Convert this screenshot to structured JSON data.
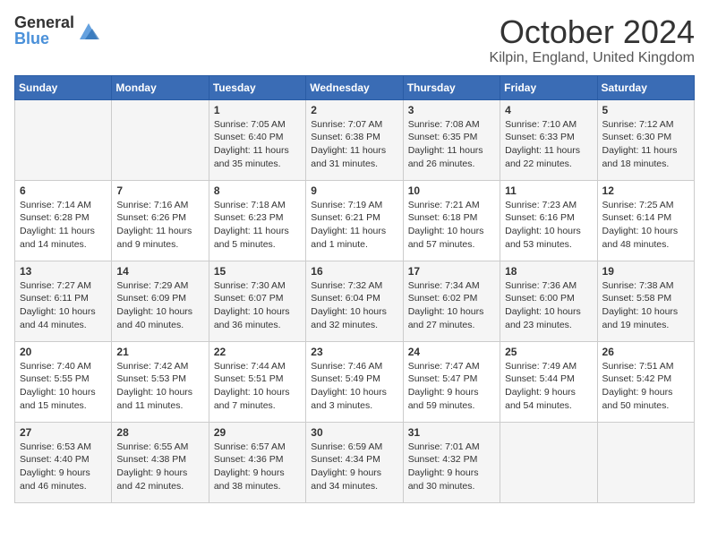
{
  "header": {
    "logo_general": "General",
    "logo_blue": "Blue",
    "month_title": "October 2024",
    "location": "Kilpin, England, United Kingdom"
  },
  "weekdays": [
    "Sunday",
    "Monday",
    "Tuesday",
    "Wednesday",
    "Thursday",
    "Friday",
    "Saturday"
  ],
  "weeks": [
    [
      {
        "day": "",
        "info": ""
      },
      {
        "day": "",
        "info": ""
      },
      {
        "day": "1",
        "info": "Sunrise: 7:05 AM\nSunset: 6:40 PM\nDaylight: 11 hours and 35 minutes."
      },
      {
        "day": "2",
        "info": "Sunrise: 7:07 AM\nSunset: 6:38 PM\nDaylight: 11 hours and 31 minutes."
      },
      {
        "day": "3",
        "info": "Sunrise: 7:08 AM\nSunset: 6:35 PM\nDaylight: 11 hours and 26 minutes."
      },
      {
        "day": "4",
        "info": "Sunrise: 7:10 AM\nSunset: 6:33 PM\nDaylight: 11 hours and 22 minutes."
      },
      {
        "day": "5",
        "info": "Sunrise: 7:12 AM\nSunset: 6:30 PM\nDaylight: 11 hours and 18 minutes."
      }
    ],
    [
      {
        "day": "6",
        "info": "Sunrise: 7:14 AM\nSunset: 6:28 PM\nDaylight: 11 hours and 14 minutes."
      },
      {
        "day": "7",
        "info": "Sunrise: 7:16 AM\nSunset: 6:26 PM\nDaylight: 11 hours and 9 minutes."
      },
      {
        "day": "8",
        "info": "Sunrise: 7:18 AM\nSunset: 6:23 PM\nDaylight: 11 hours and 5 minutes."
      },
      {
        "day": "9",
        "info": "Sunrise: 7:19 AM\nSunset: 6:21 PM\nDaylight: 11 hours and 1 minute."
      },
      {
        "day": "10",
        "info": "Sunrise: 7:21 AM\nSunset: 6:18 PM\nDaylight: 10 hours and 57 minutes."
      },
      {
        "day": "11",
        "info": "Sunrise: 7:23 AM\nSunset: 6:16 PM\nDaylight: 10 hours and 53 minutes."
      },
      {
        "day": "12",
        "info": "Sunrise: 7:25 AM\nSunset: 6:14 PM\nDaylight: 10 hours and 48 minutes."
      }
    ],
    [
      {
        "day": "13",
        "info": "Sunrise: 7:27 AM\nSunset: 6:11 PM\nDaylight: 10 hours and 44 minutes."
      },
      {
        "day": "14",
        "info": "Sunrise: 7:29 AM\nSunset: 6:09 PM\nDaylight: 10 hours and 40 minutes."
      },
      {
        "day": "15",
        "info": "Sunrise: 7:30 AM\nSunset: 6:07 PM\nDaylight: 10 hours and 36 minutes."
      },
      {
        "day": "16",
        "info": "Sunrise: 7:32 AM\nSunset: 6:04 PM\nDaylight: 10 hours and 32 minutes."
      },
      {
        "day": "17",
        "info": "Sunrise: 7:34 AM\nSunset: 6:02 PM\nDaylight: 10 hours and 27 minutes."
      },
      {
        "day": "18",
        "info": "Sunrise: 7:36 AM\nSunset: 6:00 PM\nDaylight: 10 hours and 23 minutes."
      },
      {
        "day": "19",
        "info": "Sunrise: 7:38 AM\nSunset: 5:58 PM\nDaylight: 10 hours and 19 minutes."
      }
    ],
    [
      {
        "day": "20",
        "info": "Sunrise: 7:40 AM\nSunset: 5:55 PM\nDaylight: 10 hours and 15 minutes."
      },
      {
        "day": "21",
        "info": "Sunrise: 7:42 AM\nSunset: 5:53 PM\nDaylight: 10 hours and 11 minutes."
      },
      {
        "day": "22",
        "info": "Sunrise: 7:44 AM\nSunset: 5:51 PM\nDaylight: 10 hours and 7 minutes."
      },
      {
        "day": "23",
        "info": "Sunrise: 7:46 AM\nSunset: 5:49 PM\nDaylight: 10 hours and 3 minutes."
      },
      {
        "day": "24",
        "info": "Sunrise: 7:47 AM\nSunset: 5:47 PM\nDaylight: 9 hours and 59 minutes."
      },
      {
        "day": "25",
        "info": "Sunrise: 7:49 AM\nSunset: 5:44 PM\nDaylight: 9 hours and 54 minutes."
      },
      {
        "day": "26",
        "info": "Sunrise: 7:51 AM\nSunset: 5:42 PM\nDaylight: 9 hours and 50 minutes."
      }
    ],
    [
      {
        "day": "27",
        "info": "Sunrise: 6:53 AM\nSunset: 4:40 PM\nDaylight: 9 hours and 46 minutes."
      },
      {
        "day": "28",
        "info": "Sunrise: 6:55 AM\nSunset: 4:38 PM\nDaylight: 9 hours and 42 minutes."
      },
      {
        "day": "29",
        "info": "Sunrise: 6:57 AM\nSunset: 4:36 PM\nDaylight: 9 hours and 38 minutes."
      },
      {
        "day": "30",
        "info": "Sunrise: 6:59 AM\nSunset: 4:34 PM\nDaylight: 9 hours and 34 minutes."
      },
      {
        "day": "31",
        "info": "Sunrise: 7:01 AM\nSunset: 4:32 PM\nDaylight: 9 hours and 30 minutes."
      },
      {
        "day": "",
        "info": ""
      },
      {
        "day": "",
        "info": ""
      }
    ]
  ]
}
